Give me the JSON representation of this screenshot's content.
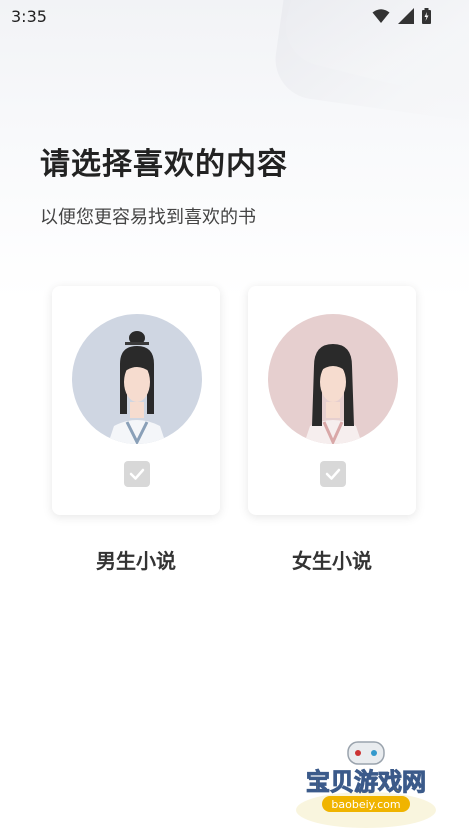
{
  "status_bar": {
    "time": "3:35"
  },
  "header": {
    "title": "请选择喜欢的内容",
    "subtitle": "以便您更容易找到喜欢的书"
  },
  "options": [
    {
      "label": "男生小说",
      "selected": false,
      "icon": "male-avatar-icon",
      "avatar_bg": "#cfd6e2"
    },
    {
      "label": "女生小说",
      "selected": false,
      "icon": "female-avatar-icon",
      "avatar_bg": "#e6cfcf"
    }
  ],
  "watermark": {
    "text": "宝贝游戏网",
    "url_text": "baobeiy.com"
  }
}
